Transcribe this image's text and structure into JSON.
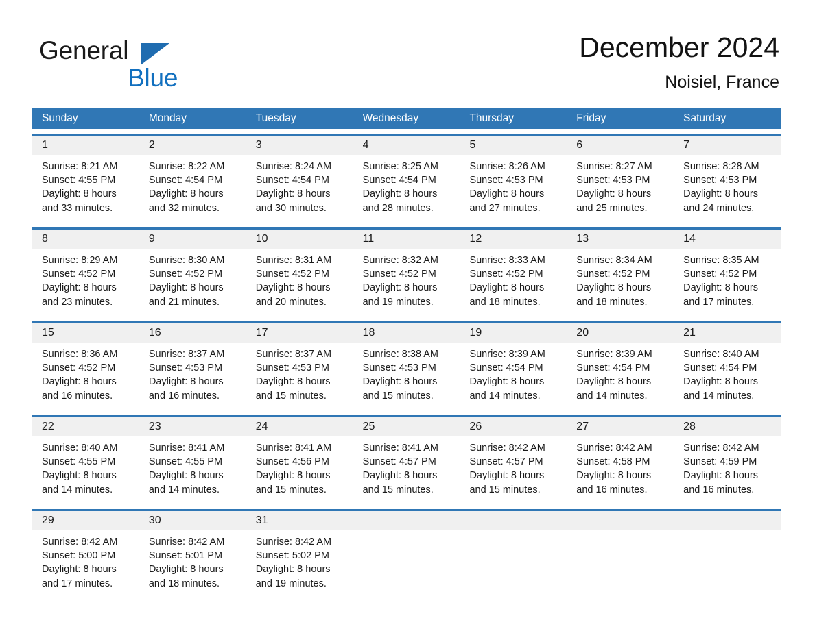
{
  "brand": {
    "name_part1": "General",
    "name_part2": "Blue",
    "triangle_color": "#1f6cb0",
    "blue_color": "#1270bf"
  },
  "header": {
    "title": "December 2024",
    "subtitle": "Noisiel, France"
  },
  "theme": {
    "header_blue": "#3077b5",
    "daynum_band": "#f0f0f0",
    "text": "#1a1a1a",
    "header_text": "#ffffff"
  },
  "weekdays": [
    "Sunday",
    "Monday",
    "Tuesday",
    "Wednesday",
    "Thursday",
    "Friday",
    "Saturday"
  ],
  "labels": {
    "sunrise_prefix": "Sunrise:",
    "sunset_prefix": "Sunset:",
    "daylight_prefix": "Daylight:"
  },
  "weeks": [
    {
      "days": [
        {
          "num": "1",
          "sunrise": "Sunrise: 8:21 AM",
          "sunset": "Sunset: 4:55 PM",
          "daylight_l1": "Daylight: 8 hours",
          "daylight_l2": "and 33 minutes."
        },
        {
          "num": "2",
          "sunrise": "Sunrise: 8:22 AM",
          "sunset": "Sunset: 4:54 PM",
          "daylight_l1": "Daylight: 8 hours",
          "daylight_l2": "and 32 minutes."
        },
        {
          "num": "3",
          "sunrise": "Sunrise: 8:24 AM",
          "sunset": "Sunset: 4:54 PM",
          "daylight_l1": "Daylight: 8 hours",
          "daylight_l2": "and 30 minutes."
        },
        {
          "num": "4",
          "sunrise": "Sunrise: 8:25 AM",
          "sunset": "Sunset: 4:54 PM",
          "daylight_l1": "Daylight: 8 hours",
          "daylight_l2": "and 28 minutes."
        },
        {
          "num": "5",
          "sunrise": "Sunrise: 8:26 AM",
          "sunset": "Sunset: 4:53 PM",
          "daylight_l1": "Daylight: 8 hours",
          "daylight_l2": "and 27 minutes."
        },
        {
          "num": "6",
          "sunrise": "Sunrise: 8:27 AM",
          "sunset": "Sunset: 4:53 PM",
          "daylight_l1": "Daylight: 8 hours",
          "daylight_l2": "and 25 minutes."
        },
        {
          "num": "7",
          "sunrise": "Sunrise: 8:28 AM",
          "sunset": "Sunset: 4:53 PM",
          "daylight_l1": "Daylight: 8 hours",
          "daylight_l2": "and 24 minutes."
        }
      ]
    },
    {
      "days": [
        {
          "num": "8",
          "sunrise": "Sunrise: 8:29 AM",
          "sunset": "Sunset: 4:52 PM",
          "daylight_l1": "Daylight: 8 hours",
          "daylight_l2": "and 23 minutes."
        },
        {
          "num": "9",
          "sunrise": "Sunrise: 8:30 AM",
          "sunset": "Sunset: 4:52 PM",
          "daylight_l1": "Daylight: 8 hours",
          "daylight_l2": "and 21 minutes."
        },
        {
          "num": "10",
          "sunrise": "Sunrise: 8:31 AM",
          "sunset": "Sunset: 4:52 PM",
          "daylight_l1": "Daylight: 8 hours",
          "daylight_l2": "and 20 minutes."
        },
        {
          "num": "11",
          "sunrise": "Sunrise: 8:32 AM",
          "sunset": "Sunset: 4:52 PM",
          "daylight_l1": "Daylight: 8 hours",
          "daylight_l2": "and 19 minutes."
        },
        {
          "num": "12",
          "sunrise": "Sunrise: 8:33 AM",
          "sunset": "Sunset: 4:52 PM",
          "daylight_l1": "Daylight: 8 hours",
          "daylight_l2": "and 18 minutes."
        },
        {
          "num": "13",
          "sunrise": "Sunrise: 8:34 AM",
          "sunset": "Sunset: 4:52 PM",
          "daylight_l1": "Daylight: 8 hours",
          "daylight_l2": "and 18 minutes."
        },
        {
          "num": "14",
          "sunrise": "Sunrise: 8:35 AM",
          "sunset": "Sunset: 4:52 PM",
          "daylight_l1": "Daylight: 8 hours",
          "daylight_l2": "and 17 minutes."
        }
      ]
    },
    {
      "days": [
        {
          "num": "15",
          "sunrise": "Sunrise: 8:36 AM",
          "sunset": "Sunset: 4:52 PM",
          "daylight_l1": "Daylight: 8 hours",
          "daylight_l2": "and 16 minutes."
        },
        {
          "num": "16",
          "sunrise": "Sunrise: 8:37 AM",
          "sunset": "Sunset: 4:53 PM",
          "daylight_l1": "Daylight: 8 hours",
          "daylight_l2": "and 16 minutes."
        },
        {
          "num": "17",
          "sunrise": "Sunrise: 8:37 AM",
          "sunset": "Sunset: 4:53 PM",
          "daylight_l1": "Daylight: 8 hours",
          "daylight_l2": "and 15 minutes."
        },
        {
          "num": "18",
          "sunrise": "Sunrise: 8:38 AM",
          "sunset": "Sunset: 4:53 PM",
          "daylight_l1": "Daylight: 8 hours",
          "daylight_l2": "and 15 minutes."
        },
        {
          "num": "19",
          "sunrise": "Sunrise: 8:39 AM",
          "sunset": "Sunset: 4:54 PM",
          "daylight_l1": "Daylight: 8 hours",
          "daylight_l2": "and 14 minutes."
        },
        {
          "num": "20",
          "sunrise": "Sunrise: 8:39 AM",
          "sunset": "Sunset: 4:54 PM",
          "daylight_l1": "Daylight: 8 hours",
          "daylight_l2": "and 14 minutes."
        },
        {
          "num": "21",
          "sunrise": "Sunrise: 8:40 AM",
          "sunset": "Sunset: 4:54 PM",
          "daylight_l1": "Daylight: 8 hours",
          "daylight_l2": "and 14 minutes."
        }
      ]
    },
    {
      "days": [
        {
          "num": "22",
          "sunrise": "Sunrise: 8:40 AM",
          "sunset": "Sunset: 4:55 PM",
          "daylight_l1": "Daylight: 8 hours",
          "daylight_l2": "and 14 minutes."
        },
        {
          "num": "23",
          "sunrise": "Sunrise: 8:41 AM",
          "sunset": "Sunset: 4:55 PM",
          "daylight_l1": "Daylight: 8 hours",
          "daylight_l2": "and 14 minutes."
        },
        {
          "num": "24",
          "sunrise": "Sunrise: 8:41 AM",
          "sunset": "Sunset: 4:56 PM",
          "daylight_l1": "Daylight: 8 hours",
          "daylight_l2": "and 15 minutes."
        },
        {
          "num": "25",
          "sunrise": "Sunrise: 8:41 AM",
          "sunset": "Sunset: 4:57 PM",
          "daylight_l1": "Daylight: 8 hours",
          "daylight_l2": "and 15 minutes."
        },
        {
          "num": "26",
          "sunrise": "Sunrise: 8:42 AM",
          "sunset": "Sunset: 4:57 PM",
          "daylight_l1": "Daylight: 8 hours",
          "daylight_l2": "and 15 minutes."
        },
        {
          "num": "27",
          "sunrise": "Sunrise: 8:42 AM",
          "sunset": "Sunset: 4:58 PM",
          "daylight_l1": "Daylight: 8 hours",
          "daylight_l2": "and 16 minutes."
        },
        {
          "num": "28",
          "sunrise": "Sunrise: 8:42 AM",
          "sunset": "Sunset: 4:59 PM",
          "daylight_l1": "Daylight: 8 hours",
          "daylight_l2": "and 16 minutes."
        }
      ]
    },
    {
      "days": [
        {
          "num": "29",
          "sunrise": "Sunrise: 8:42 AM",
          "sunset": "Sunset: 5:00 PM",
          "daylight_l1": "Daylight: 8 hours",
          "daylight_l2": "and 17 minutes."
        },
        {
          "num": "30",
          "sunrise": "Sunrise: 8:42 AM",
          "sunset": "Sunset: 5:01 PM",
          "daylight_l1": "Daylight: 8 hours",
          "daylight_l2": "and 18 minutes."
        },
        {
          "num": "31",
          "sunrise": "Sunrise: 8:42 AM",
          "sunset": "Sunset: 5:02 PM",
          "daylight_l1": "Daylight: 8 hours",
          "daylight_l2": "and 19 minutes."
        },
        {
          "num": "",
          "sunrise": "",
          "sunset": "",
          "daylight_l1": "",
          "daylight_l2": ""
        },
        {
          "num": "",
          "sunrise": "",
          "sunset": "",
          "daylight_l1": "",
          "daylight_l2": ""
        },
        {
          "num": "",
          "sunrise": "",
          "sunset": "",
          "daylight_l1": "",
          "daylight_l2": ""
        },
        {
          "num": "",
          "sunrise": "",
          "sunset": "",
          "daylight_l1": "",
          "daylight_l2": ""
        }
      ]
    }
  ]
}
